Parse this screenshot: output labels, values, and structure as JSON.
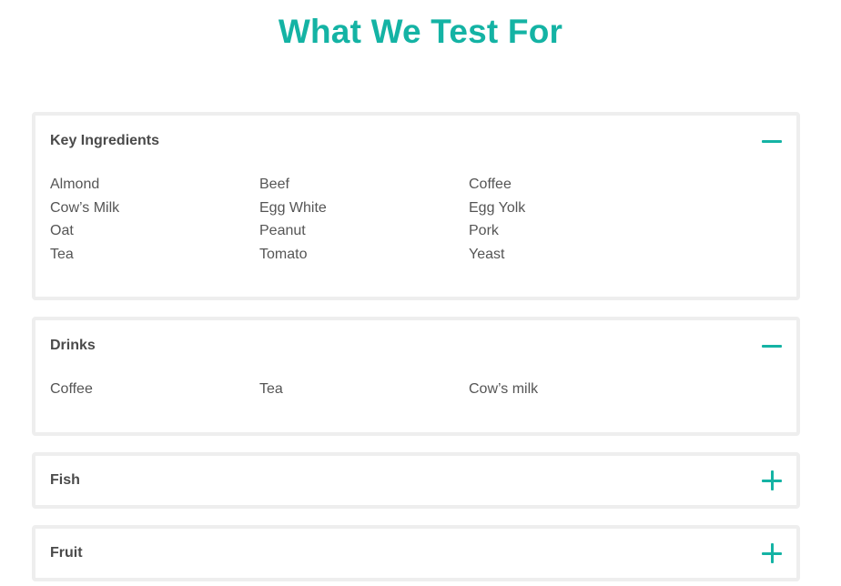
{
  "title": "What We Test For",
  "accent_color": "#14b3a4",
  "sections": [
    {
      "title": "Key Ingredients",
      "expanded": true,
      "icon": "minus-icon",
      "items": [
        "Almond",
        "Beef",
        "Coffee",
        "Cow’s Milk",
        "Egg White",
        "Egg Yolk",
        "Oat",
        "Peanut",
        "Pork",
        "Tea",
        "Tomato",
        "Yeast"
      ]
    },
    {
      "title": "Drinks",
      "expanded": true,
      "icon": "minus-icon",
      "items": [
        "Coffee",
        "Tea",
        "Cow’s milk"
      ]
    },
    {
      "title": "Fish",
      "expanded": false,
      "icon": "plus-icon",
      "items": []
    },
    {
      "title": "Fruit",
      "expanded": false,
      "icon": "plus-icon",
      "items": []
    }
  ]
}
